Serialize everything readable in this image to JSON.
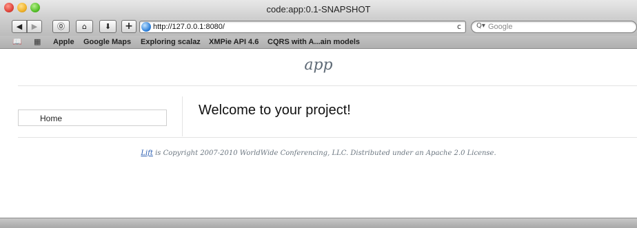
{
  "window": {
    "title": "code:app:0.1-SNAPSHOT"
  },
  "toolbar": {
    "back_icon": "back-arrow-icon",
    "forward_icon": "forward-arrow-icon",
    "history_icon": "history-icon",
    "home_icon": "home-icon",
    "downloads_icon": "download-icon",
    "add_label": "+",
    "address": "http://127.0.0.1:8080/",
    "reload_glyph": "c",
    "search_placeholder": "Google"
  },
  "bookmarks": {
    "items": [
      {
        "label": "Apple"
      },
      {
        "label": "Google Maps"
      },
      {
        "label": "Exploring scalaz"
      },
      {
        "label": "XMPie API 4.6"
      },
      {
        "label": "CQRS with A...ain models"
      }
    ]
  },
  "page": {
    "logo": "app",
    "nav": [
      {
        "label": "Home"
      }
    ],
    "heading": "Welcome to your project!",
    "footer": {
      "link_text": "Lift",
      "text": " is Copyright 2007-2010 WorldWide Conferencing, LLC. Distributed under an Apache 2.0 License."
    }
  },
  "colors": {
    "link": "#2a5db0",
    "close": "#e0443a",
    "minimize": "#f0b22a",
    "zoom": "#56c02a"
  }
}
